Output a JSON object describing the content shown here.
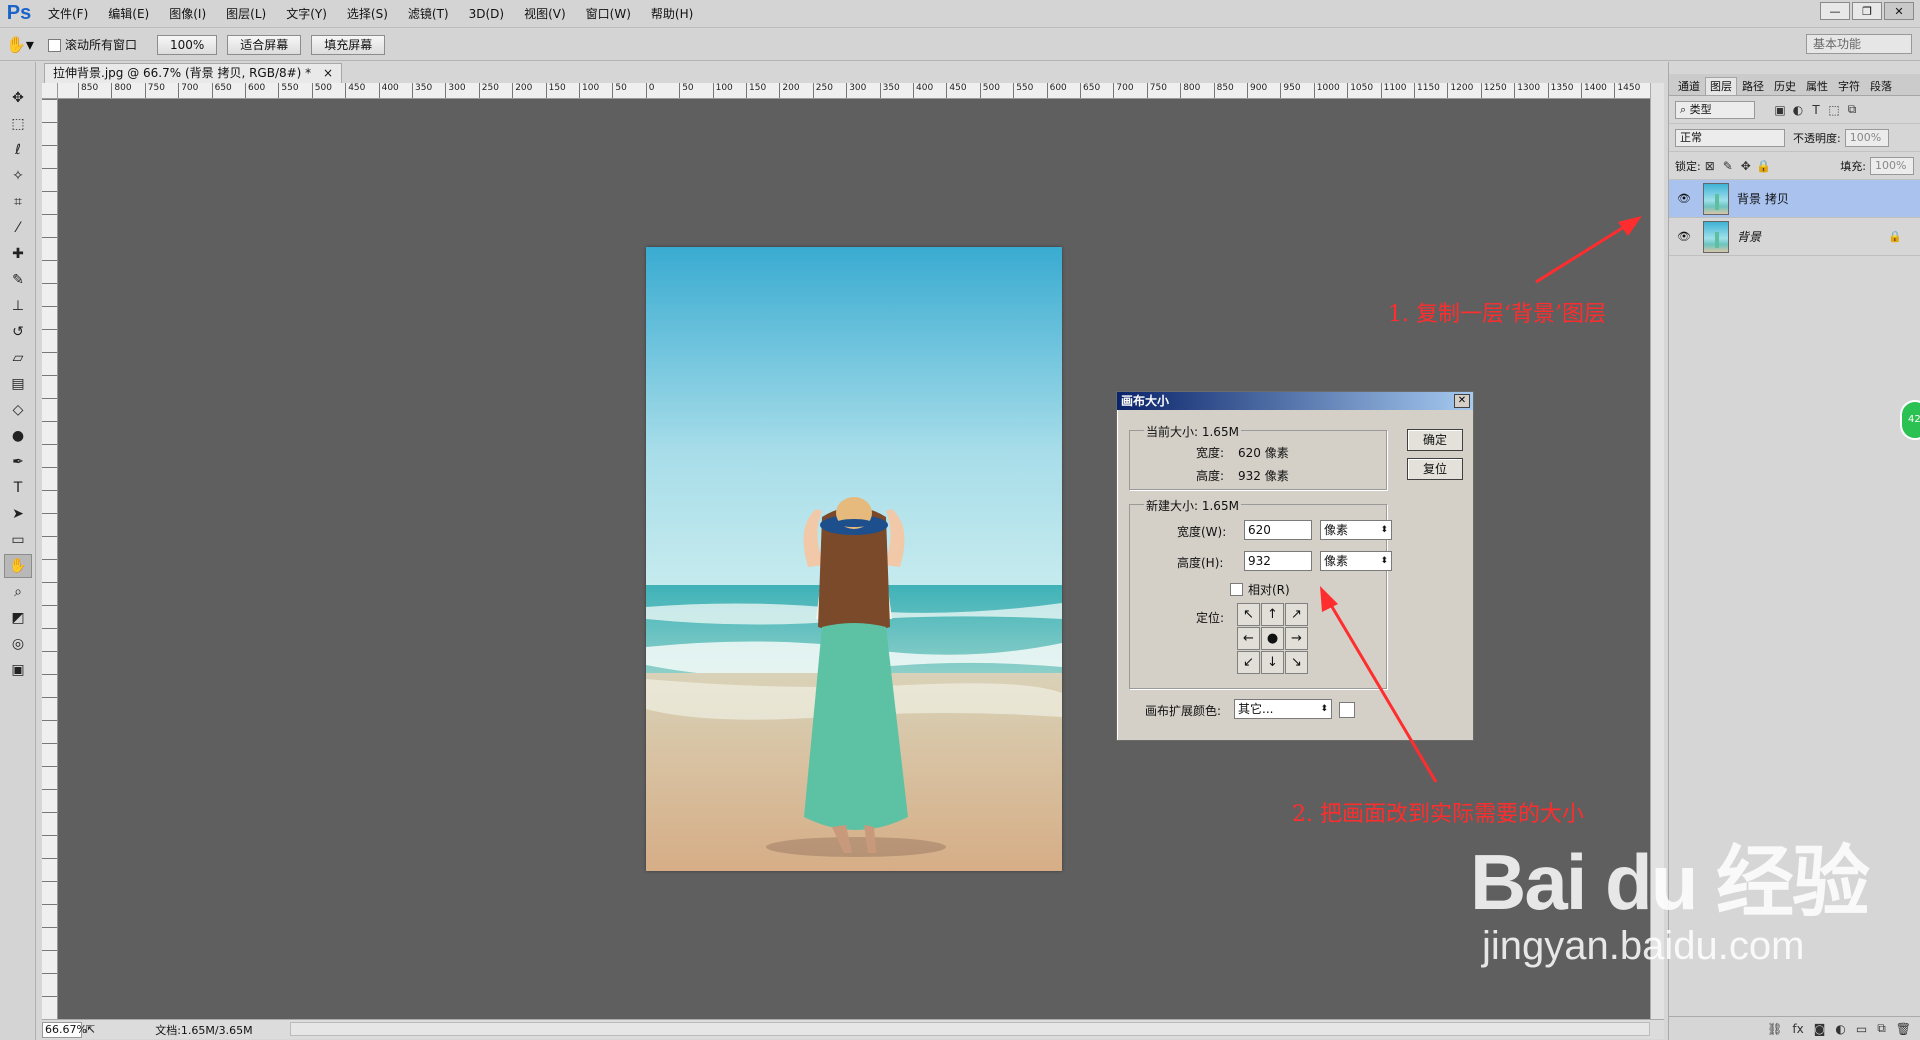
{
  "app": {
    "logo": "Ps",
    "menus": [
      "文件(F)",
      "编辑(E)",
      "图像(I)",
      "图层(L)",
      "文字(Y)",
      "选择(S)",
      "滤镜(T)",
      "3D(D)",
      "视图(V)",
      "窗口(W)",
      "帮助(H)"
    ],
    "window_controls": [
      "—",
      "❐",
      "✕"
    ]
  },
  "options_bar": {
    "scroll_all_label": "滚动所有窗口",
    "zoom_button": "100%",
    "fit_screen": "适合屏幕",
    "fill_screen": "填充屏幕",
    "workspace": "基本功能"
  },
  "document": {
    "tab_title": "拉伸背景.jpg @ 66.7% (背景 拷贝, RGB/8#) *",
    "tab_close": "×",
    "ruler_labels": [
      "850",
      "800",
      "750",
      "700",
      "650",
      "600",
      "550",
      "500",
      "450",
      "400",
      "350",
      "300",
      "250",
      "200",
      "150",
      "100",
      "50",
      "0",
      "50",
      "100",
      "150",
      "200",
      "250",
      "300",
      "350",
      "400",
      "450",
      "500",
      "550",
      "600",
      "650",
      "700",
      "750",
      "800",
      "850",
      "900",
      "950",
      "1000",
      "1050",
      "1100",
      "1150",
      "1200",
      "1250",
      "1300",
      "1350",
      "1400",
      "1450"
    ]
  },
  "status": {
    "zoom": "66.67%",
    "doc_info": "文档:1.65M/3.65M"
  },
  "layers_panel": {
    "tabs": [
      "通道",
      "图层",
      "路径",
      "历史",
      "属性",
      "字符",
      "段落"
    ],
    "active_tab": "图层",
    "filter_type": "类型",
    "blend_mode": "正常",
    "opacity_label": "不透明度:",
    "opacity_value": "100%",
    "lock_label": "锁定:",
    "fill_label": "填充:",
    "fill_value": "100%",
    "layers": [
      {
        "name": "背景 拷贝",
        "selected": true
      },
      {
        "name": "背景",
        "selected": false,
        "locked": true
      }
    ],
    "edge_badge": "42"
  },
  "dialog": {
    "title": "画布大小",
    "close": "✕",
    "current_size_label": "当前大小: 1.65M",
    "current_width_label": "宽度:",
    "current_width_value": "620 像素",
    "current_height_label": "高度:",
    "current_height_value": "932 像素",
    "new_size_label": "新建大小: 1.65M",
    "width_label": "宽度(W):",
    "width_value": "620",
    "width_unit": "像素",
    "height_label": "高度(H):",
    "height_value": "932",
    "height_unit": "像素",
    "relative_label": "相对(R)",
    "anchor_label": "定位:",
    "anchor_arrows": [
      "↖",
      "↑",
      "↗",
      "←",
      "●",
      "→",
      "↙",
      "↓",
      "↘"
    ],
    "extension_color_label": "画布扩展颜色:",
    "extension_color_value": "其它...",
    "ok": "确定",
    "reset": "复位"
  },
  "annotations": {
    "step1": "1. 复制一层‘背景’图层",
    "step2": "2. 把画面改到实际需要的大小",
    "color": "#ff2d2d"
  },
  "watermark": {
    "brand": "Bai du 经验",
    "url": "jingyan.baidu.com"
  }
}
